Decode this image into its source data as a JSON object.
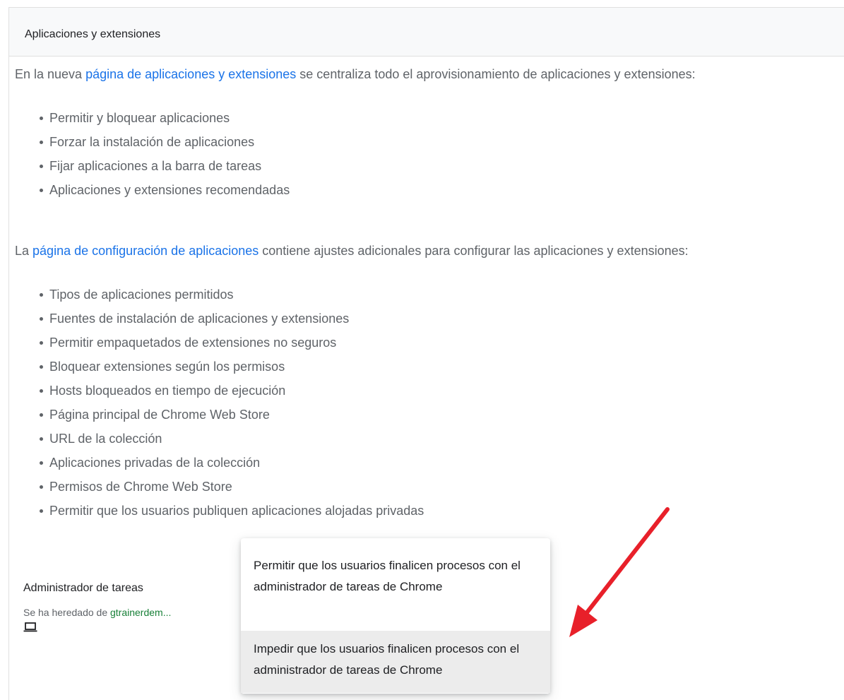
{
  "panel": {
    "title": "Aplicaciones y extensiones"
  },
  "intro": {
    "before": "En la nueva ",
    "link": "página de aplicaciones y extensiones",
    "after": " se centraliza todo el aprovisionamiento de aplicaciones y extensiones:"
  },
  "list1": [
    "Permitir y bloquear aplicaciones",
    "Forzar la instalación de aplicaciones",
    "Fijar aplicaciones a la barra de tareas",
    "Aplicaciones y extensiones recomendadas"
  ],
  "config": {
    "before": "La ",
    "link": "página de configuración de aplicaciones",
    "after": " contiene ajustes adicionales para configurar las aplicaciones y extensiones:"
  },
  "list2": [
    "Tipos de aplicaciones permitidos",
    "Fuentes de instalación de aplicaciones y extensiones",
    "Permitir empaquetados de extensiones no seguros",
    "Bloquear extensiones según los permisos",
    "Hosts bloqueados en tiempo de ejecución",
    "Página principal de Chrome Web Store",
    "URL de la colección",
    "Aplicaciones privadas de la colección",
    "Permisos de Chrome Web Store",
    "Permitir que los usuarios publiquen aplicaciones alojadas privadas"
  ],
  "setting": {
    "title": "Administrador de tareas",
    "inherited_prefix": "Se ha heredado de ",
    "inherited_link": "gtrainerdem...",
    "device_icon": "laptop-icon"
  },
  "dropdown": {
    "options": [
      "Permitir que los usuarios finalicen procesos con el administrador de tareas de Chrome",
      "Impedir que los usuarios finalicen procesos con el administrador de tareas de Chrome"
    ],
    "highlighted_index": 1
  },
  "colors": {
    "link": "#1a73e8",
    "inherited_link": "#188038",
    "arrow": "#e8202a",
    "highlight": "#ececec"
  }
}
